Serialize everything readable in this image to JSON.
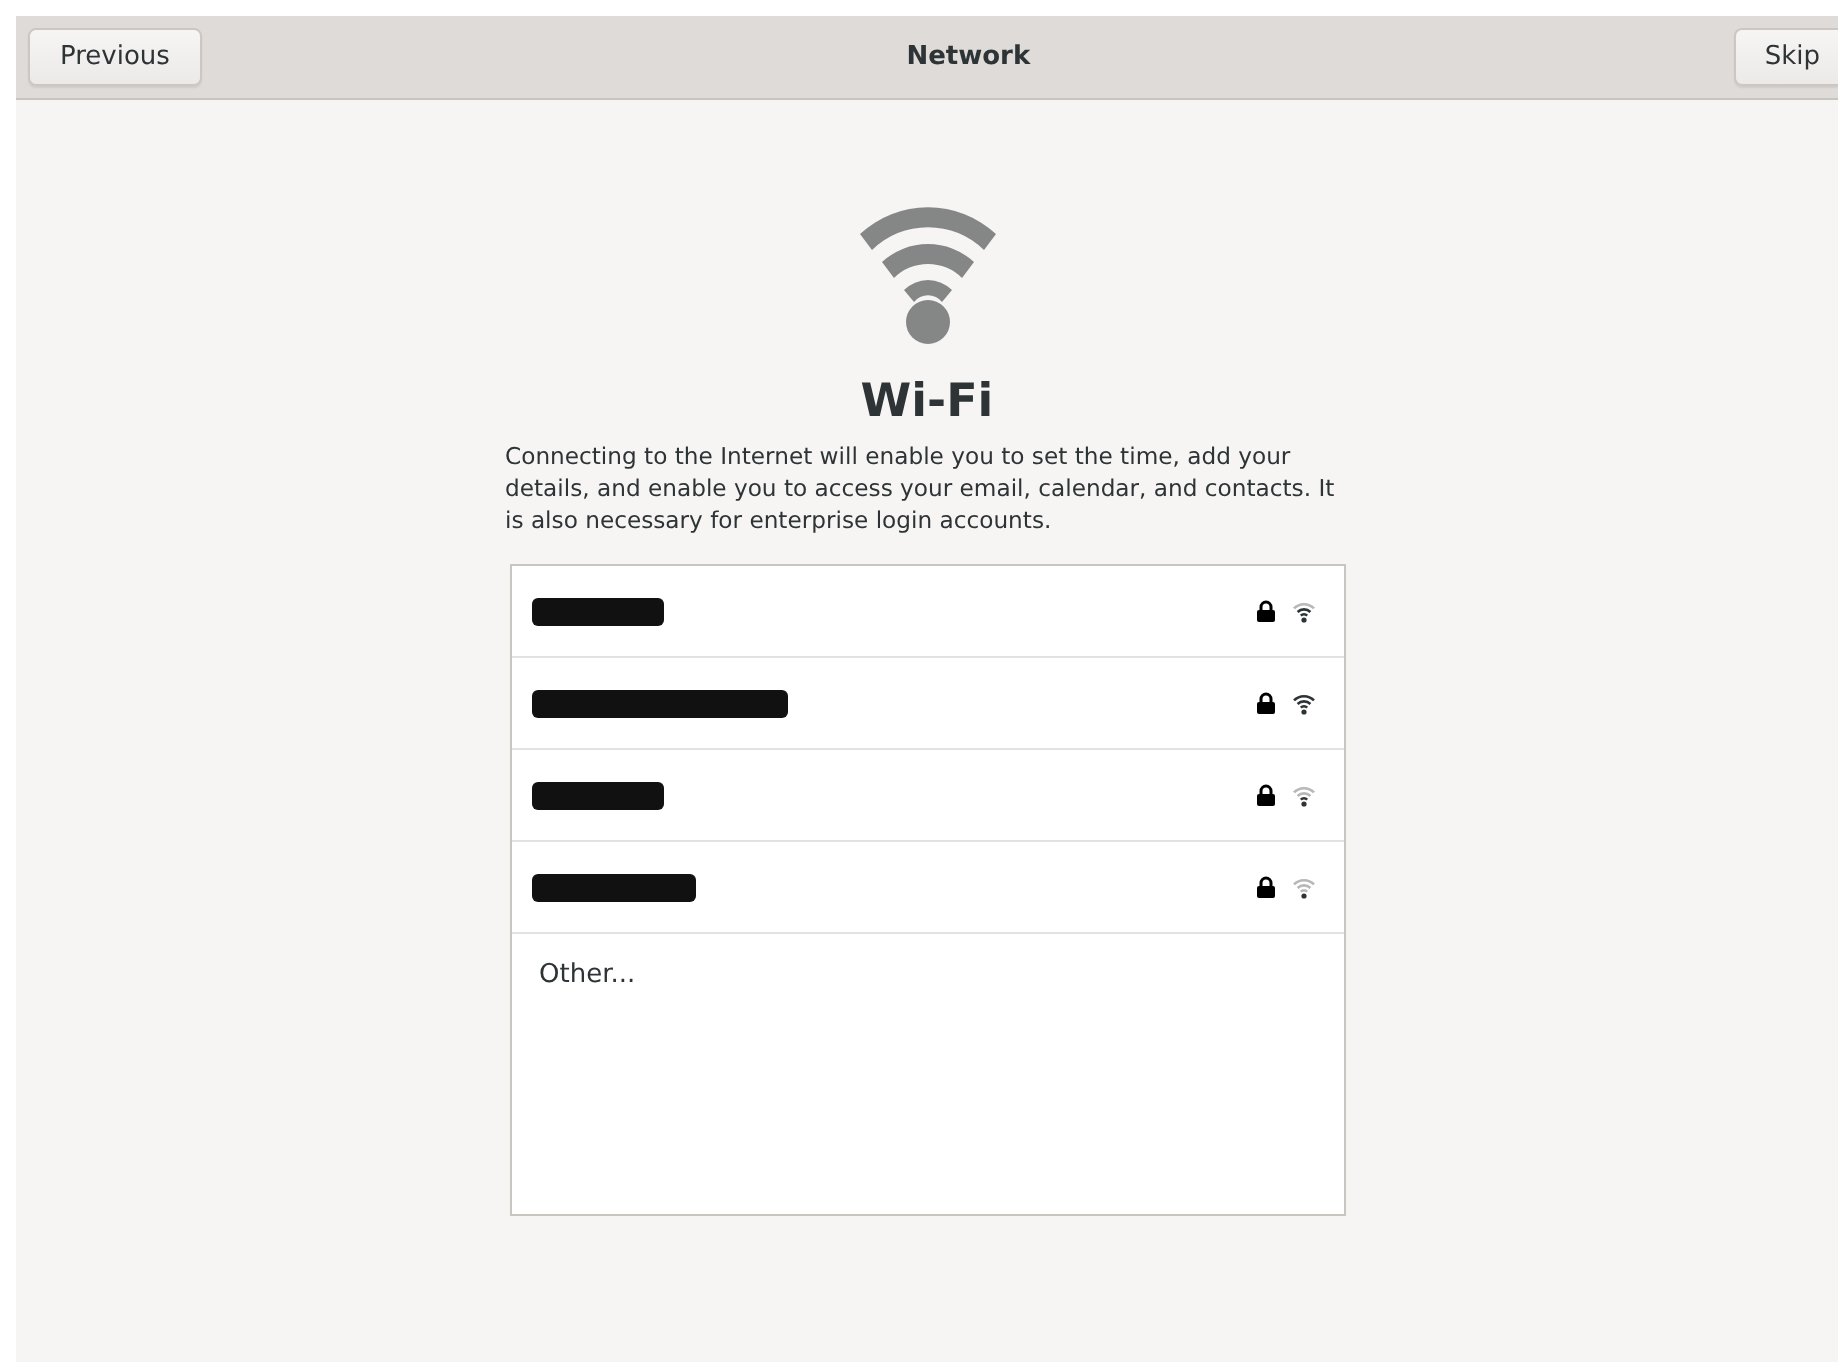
{
  "header": {
    "back_button": "Previous",
    "title": "Network",
    "skip_button": "Skip"
  },
  "page": {
    "heading": "Wi-Fi",
    "description": "Connecting to the Internet will enable you to set the time, add your details, and enable you to access your email, calendar, and contacts. It is also necessary for enterprise login accounts."
  },
  "networks": [
    {
      "secured": true
    },
    {
      "secured": true
    },
    {
      "secured": true
    },
    {
      "secured": true
    }
  ],
  "other_item": "Other..."
}
